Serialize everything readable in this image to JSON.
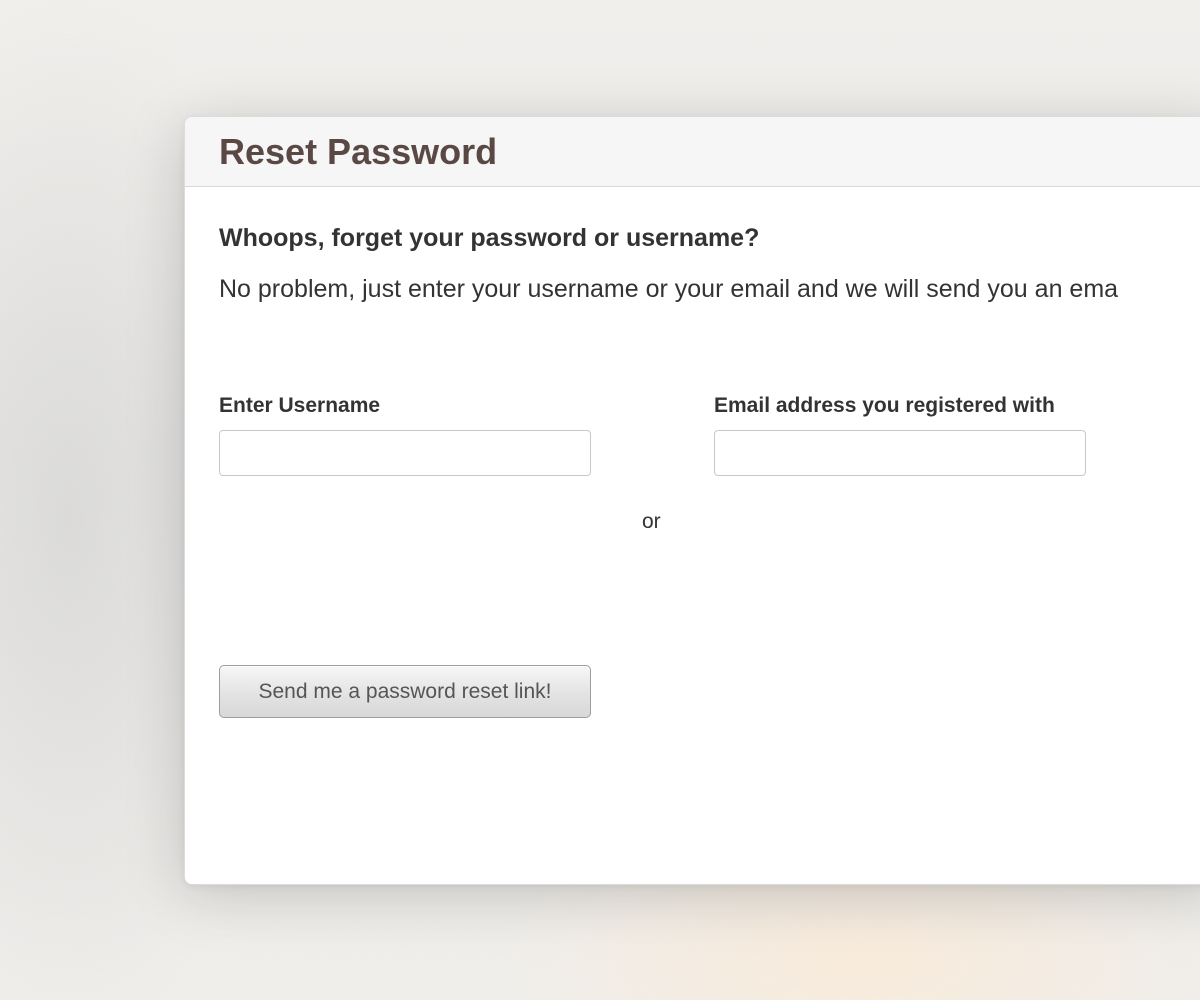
{
  "dialog": {
    "title": "Reset Password",
    "subheading": "Whoops, forget your password or username?",
    "description": "No problem, just enter your username or your email and we will send you an ema"
  },
  "form": {
    "username_label": "Enter Username",
    "username_value": "",
    "separator": "or",
    "email_label": "Email address you registered with",
    "email_value": "",
    "submit_label": "Send me a password reset link!"
  },
  "colors": {
    "title": "#5a4844",
    "text": "#333333",
    "header_background": "#f6f6f6",
    "button_text": "#555555"
  }
}
